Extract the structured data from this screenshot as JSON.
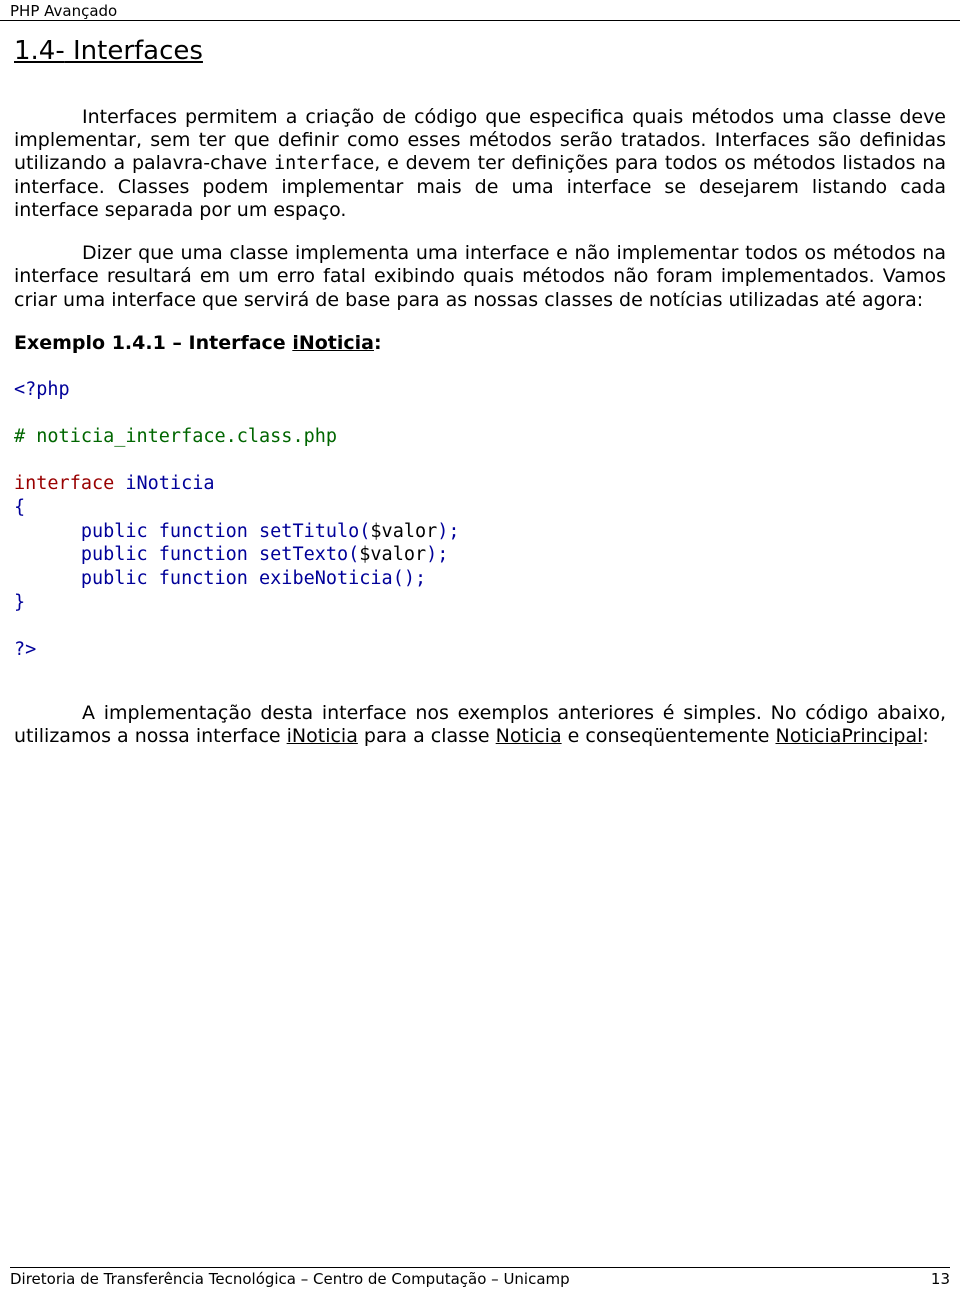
{
  "header": {
    "text": "PHP Avançado"
  },
  "section": {
    "number": "1.4-",
    "title": " Interfaces"
  },
  "para1": {
    "t1": "Interfaces permitem a criação de código que especifica quais métodos uma classe deve implementar, sem ter que definir como esses métodos serão tratados. Interfaces são definidas utilizando a palavra-chave ",
    "kw": "interface",
    "t2": ", e devem ter definições para todos os métodos listados na interface. Classes podem implementar mais de uma interface se desejarem listando cada interface separada por um espaço."
  },
  "para2": "Dizer que uma classe implementa uma interface e não implementar todos os métodos na interface resultará em um erro fatal exibindo quais métodos não foram implementados. Vamos criar uma interface que servirá de base para as nossas classes de notícias utilizadas até agora:",
  "example": {
    "label_prefix": "Exemplo 1.4.1 – Interface ",
    "name": "iNoticia",
    "suffix": ":"
  },
  "code": {
    "open": "<?php",
    "comment": "# noticia_interface.class.php",
    "iface_kw": "interface",
    "iface_name": " iNoticia",
    "brace_open": "{",
    "l1a": "      public function setTitulo(",
    "l1b": "$valor",
    "l1c": ");",
    "l2a": "      public function setTexto(",
    "l2b": "$valor",
    "l2c": ");",
    "l3": "      public function exibeNoticia();",
    "brace_close": "}",
    "close": "?>"
  },
  "para3": {
    "t1": "A implementação desta interface nos exemplos anteriores é simples. No código abaixo, utilizamos a nossa interface ",
    "u1": "iNoticia",
    "t2": " para a classe ",
    "u2": "Noticia",
    "t3": " e conseqüentemente ",
    "u3": "NoticiaPrincipal",
    "t4": ":"
  },
  "footer": {
    "left": "Diretoria de Transferência Tecnológica – Centro de Computação – Unicamp",
    "right": "13"
  }
}
